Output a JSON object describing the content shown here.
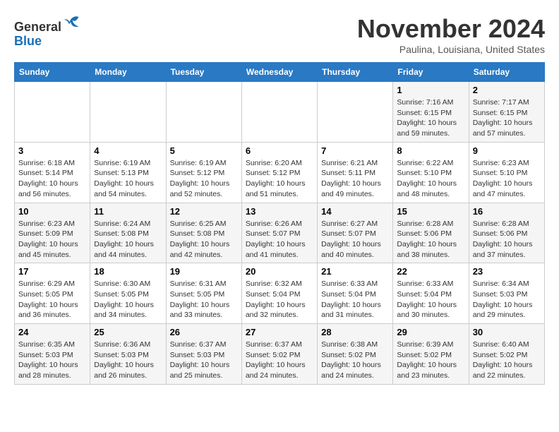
{
  "header": {
    "logo_line1": "General",
    "logo_line2": "Blue",
    "month_title": "November 2024",
    "location": "Paulina, Louisiana, United States"
  },
  "weekdays": [
    "Sunday",
    "Monday",
    "Tuesday",
    "Wednesday",
    "Thursday",
    "Friday",
    "Saturday"
  ],
  "weeks": [
    [
      {
        "day": "",
        "info": ""
      },
      {
        "day": "",
        "info": ""
      },
      {
        "day": "",
        "info": ""
      },
      {
        "day": "",
        "info": ""
      },
      {
        "day": "",
        "info": ""
      },
      {
        "day": "1",
        "info": "Sunrise: 7:16 AM\nSunset: 6:15 PM\nDaylight: 10 hours\nand 59 minutes."
      },
      {
        "day": "2",
        "info": "Sunrise: 7:17 AM\nSunset: 6:15 PM\nDaylight: 10 hours\nand 57 minutes."
      }
    ],
    [
      {
        "day": "3",
        "info": "Sunrise: 6:18 AM\nSunset: 5:14 PM\nDaylight: 10 hours\nand 56 minutes."
      },
      {
        "day": "4",
        "info": "Sunrise: 6:19 AM\nSunset: 5:13 PM\nDaylight: 10 hours\nand 54 minutes."
      },
      {
        "day": "5",
        "info": "Sunrise: 6:19 AM\nSunset: 5:12 PM\nDaylight: 10 hours\nand 52 minutes."
      },
      {
        "day": "6",
        "info": "Sunrise: 6:20 AM\nSunset: 5:12 PM\nDaylight: 10 hours\nand 51 minutes."
      },
      {
        "day": "7",
        "info": "Sunrise: 6:21 AM\nSunset: 5:11 PM\nDaylight: 10 hours\nand 49 minutes."
      },
      {
        "day": "8",
        "info": "Sunrise: 6:22 AM\nSunset: 5:10 PM\nDaylight: 10 hours\nand 48 minutes."
      },
      {
        "day": "9",
        "info": "Sunrise: 6:23 AM\nSunset: 5:10 PM\nDaylight: 10 hours\nand 47 minutes."
      }
    ],
    [
      {
        "day": "10",
        "info": "Sunrise: 6:23 AM\nSunset: 5:09 PM\nDaylight: 10 hours\nand 45 minutes."
      },
      {
        "day": "11",
        "info": "Sunrise: 6:24 AM\nSunset: 5:08 PM\nDaylight: 10 hours\nand 44 minutes."
      },
      {
        "day": "12",
        "info": "Sunrise: 6:25 AM\nSunset: 5:08 PM\nDaylight: 10 hours\nand 42 minutes."
      },
      {
        "day": "13",
        "info": "Sunrise: 6:26 AM\nSunset: 5:07 PM\nDaylight: 10 hours\nand 41 minutes."
      },
      {
        "day": "14",
        "info": "Sunrise: 6:27 AM\nSunset: 5:07 PM\nDaylight: 10 hours\nand 40 minutes."
      },
      {
        "day": "15",
        "info": "Sunrise: 6:28 AM\nSunset: 5:06 PM\nDaylight: 10 hours\nand 38 minutes."
      },
      {
        "day": "16",
        "info": "Sunrise: 6:28 AM\nSunset: 5:06 PM\nDaylight: 10 hours\nand 37 minutes."
      }
    ],
    [
      {
        "day": "17",
        "info": "Sunrise: 6:29 AM\nSunset: 5:05 PM\nDaylight: 10 hours\nand 36 minutes."
      },
      {
        "day": "18",
        "info": "Sunrise: 6:30 AM\nSunset: 5:05 PM\nDaylight: 10 hours\nand 34 minutes."
      },
      {
        "day": "19",
        "info": "Sunrise: 6:31 AM\nSunset: 5:05 PM\nDaylight: 10 hours\nand 33 minutes."
      },
      {
        "day": "20",
        "info": "Sunrise: 6:32 AM\nSunset: 5:04 PM\nDaylight: 10 hours\nand 32 minutes."
      },
      {
        "day": "21",
        "info": "Sunrise: 6:33 AM\nSunset: 5:04 PM\nDaylight: 10 hours\nand 31 minutes."
      },
      {
        "day": "22",
        "info": "Sunrise: 6:33 AM\nSunset: 5:04 PM\nDaylight: 10 hours\nand 30 minutes."
      },
      {
        "day": "23",
        "info": "Sunrise: 6:34 AM\nSunset: 5:03 PM\nDaylight: 10 hours\nand 29 minutes."
      }
    ],
    [
      {
        "day": "24",
        "info": "Sunrise: 6:35 AM\nSunset: 5:03 PM\nDaylight: 10 hours\nand 28 minutes."
      },
      {
        "day": "25",
        "info": "Sunrise: 6:36 AM\nSunset: 5:03 PM\nDaylight: 10 hours\nand 26 minutes."
      },
      {
        "day": "26",
        "info": "Sunrise: 6:37 AM\nSunset: 5:03 PM\nDaylight: 10 hours\nand 25 minutes."
      },
      {
        "day": "27",
        "info": "Sunrise: 6:37 AM\nSunset: 5:02 PM\nDaylight: 10 hours\nand 24 minutes."
      },
      {
        "day": "28",
        "info": "Sunrise: 6:38 AM\nSunset: 5:02 PM\nDaylight: 10 hours\nand 24 minutes."
      },
      {
        "day": "29",
        "info": "Sunrise: 6:39 AM\nSunset: 5:02 PM\nDaylight: 10 hours\nand 23 minutes."
      },
      {
        "day": "30",
        "info": "Sunrise: 6:40 AM\nSunset: 5:02 PM\nDaylight: 10 hours\nand 22 minutes."
      }
    ]
  ]
}
